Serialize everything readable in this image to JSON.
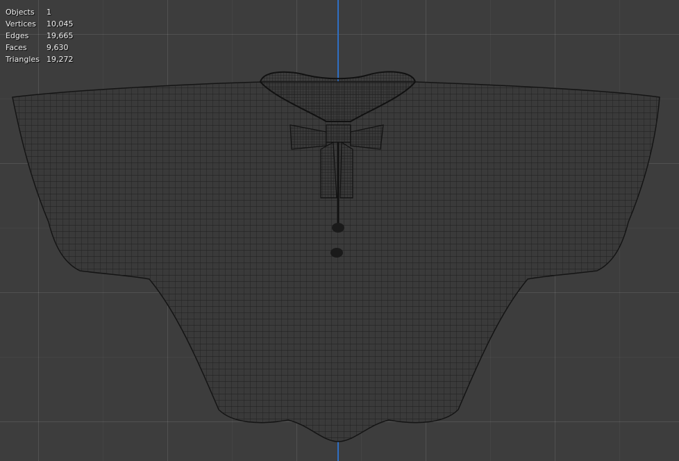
{
  "stats": [
    {
      "label": "Objects",
      "value": "1"
    },
    {
      "label": "Vertices",
      "value": "10,045"
    },
    {
      "label": "Edges",
      "value": "19,665"
    },
    {
      "label": "Faces",
      "value": "9,630"
    },
    {
      "label": "Triangles",
      "value": "19,272"
    }
  ],
  "colors": {
    "background": "#3d3d3d",
    "axis": "#2f6fc4",
    "wire": "#1a1a1a"
  }
}
